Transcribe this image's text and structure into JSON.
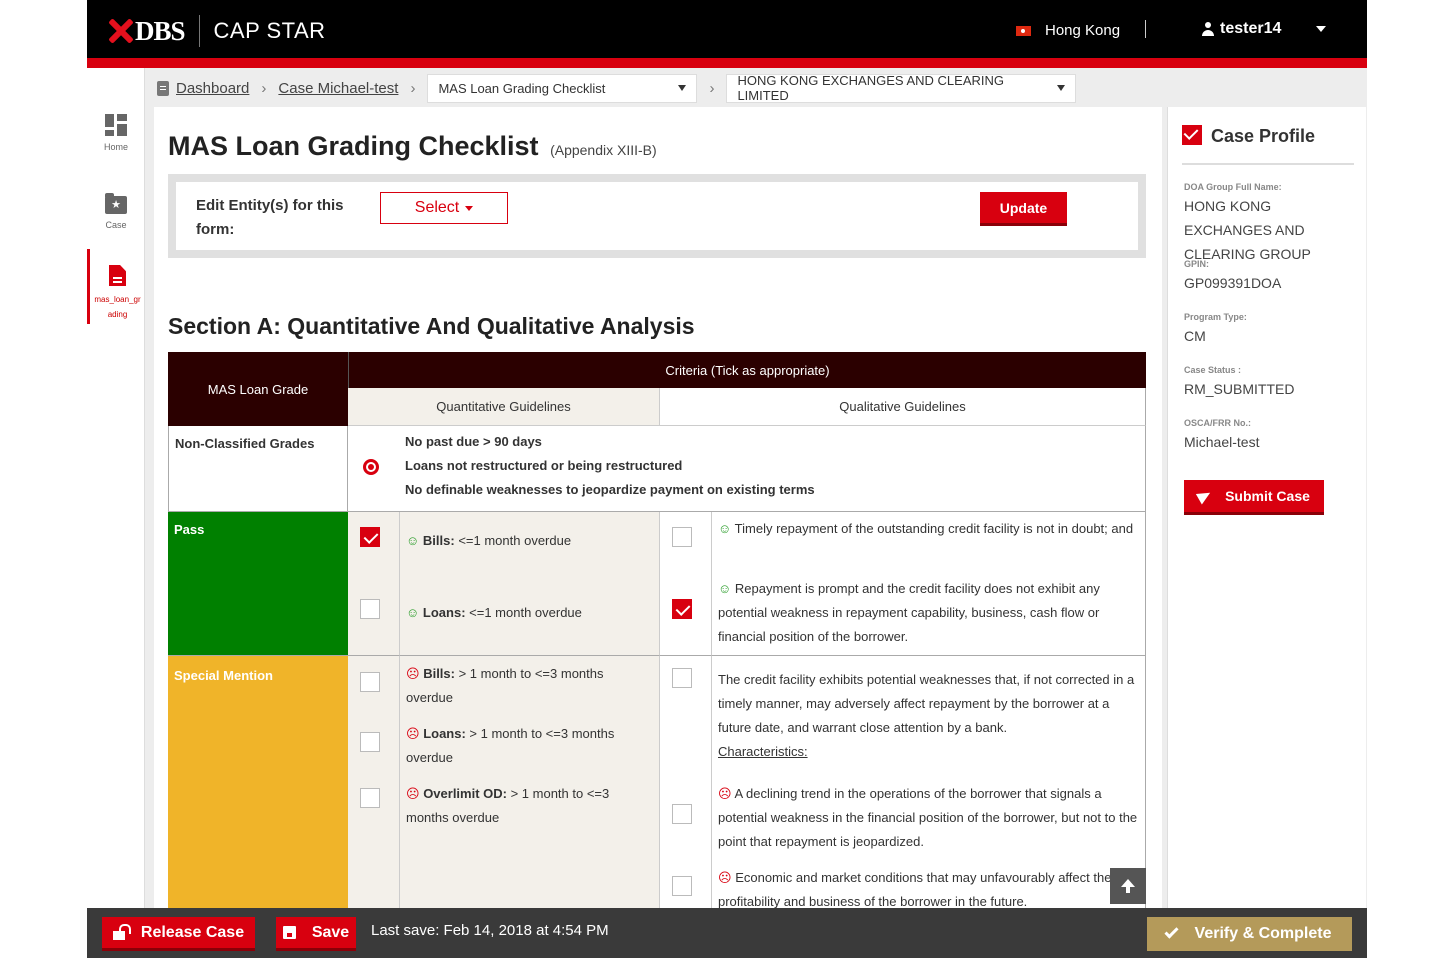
{
  "header": {
    "brand": "DBS",
    "product": "CAP STAR",
    "region": "Hong Kong",
    "user": "tester14"
  },
  "sidebar": {
    "items": [
      {
        "label": "Home",
        "icon": "dashboard-icon"
      },
      {
        "label": "Case",
        "icon": "folder-star-icon"
      },
      {
        "label": "mas_loan_grading",
        "label_lines": [
          "mas_loan_gr",
          "ading"
        ],
        "icon": "document-icon"
      }
    ]
  },
  "breadcrumb": {
    "dashboard": "Dashboard",
    "case": "Case Michael-test",
    "form_select": "MAS Loan Grading Checklist",
    "entity_select": "HONG KONG EXCHANGES AND CLEARING LIMITED"
  },
  "page": {
    "title": "MAS Loan Grading Checklist",
    "subtitle": "(Appendix XIII-B)",
    "edit_label": "Edit Entity(s) for this form:",
    "select_label": "Select",
    "update_label": "Update",
    "section_title": "Section A: Quantitative And Qualitative Analysis"
  },
  "table": {
    "col_grade": "MAS Loan Grade",
    "col_criteria": "Criteria (Tick as appropriate)",
    "col_quant": "Quantitative Guidelines",
    "col_qual": "Qualitative Guidelines",
    "non_classified": {
      "label": "Non-Classified Grades",
      "selected": true,
      "lines": [
        "No past due > 90 days",
        "Loans not restructured or being restructured",
        "No definable weaknesses to jeopardize payment on existing terms"
      ]
    },
    "pass": {
      "label": "Pass",
      "color": "#008000",
      "quant": [
        {
          "bold": "Bills:",
          "text": " <=1 month overdue",
          "checked": true
        },
        {
          "bold": "Loans:",
          "text": " <=1 month overdue",
          "checked": false
        }
      ],
      "qual": [
        {
          "text": "Timely repayment of the outstanding credit facility is not in doubt; and",
          "checked": false
        },
        {
          "text": "Repayment is prompt and the credit facility does not exhibit any potential weakness in repayment capability, business, cash flow or financial position of the borrower.",
          "checked": true
        }
      ]
    },
    "special": {
      "label": "Special Mention",
      "color": "#f0b429",
      "quant": [
        {
          "bold": "Bills:",
          "text": " > 1 month to <=3 months overdue",
          "checked": false
        },
        {
          "bold": "Loans:",
          "text": " > 1 month to <=3 months overdue",
          "checked": false
        },
        {
          "bold": "Overlimit OD:",
          "text": " > 1 month to <=3 months overdue",
          "checked": false
        }
      ],
      "qual_intro": "The credit facility exhibits potential weaknesses that, if not corrected in a timely manner, may adversely affect repayment by the borrower at a future date, and warrant close attention by a bank.",
      "qual_char": "Characteristics:",
      "qual": [
        {
          "text": "A declining trend in the operations of the borrower that signals a potential weakness in the financial position of the borrower, but not to the point that repayment is jeopardized.",
          "checked": false
        },
        {
          "text": "Economic and market conditions that may unfavourably affect the profitability and business of the borrower in the future.",
          "checked": false
        }
      ]
    }
  },
  "case_profile": {
    "title": "Case Profile",
    "fields": [
      {
        "label": "DOA Group Full Name:",
        "value": "HONG KONG EXCHANGES AND CLEARING GROUP"
      },
      {
        "label": "GPIN:",
        "value": "GP099391DOA"
      },
      {
        "label": "Program Type:",
        "value": "CM"
      },
      {
        "label": "Case Status :",
        "value": "RM_SUBMITTED"
      },
      {
        "label": "OSCA/FRR No.:",
        "value": "Michael-test"
      }
    ],
    "submit_label": "Submit Case"
  },
  "footer": {
    "release_label": "Release Case",
    "save_label": "Save",
    "last_save": "Last save: Feb 14, 2018 at 4:54 PM",
    "verify_label": "Verify & Complete"
  },
  "colors": {
    "accent": "#d8000f",
    "header_dark": "#2b0000",
    "verify": "#b49a5a"
  }
}
